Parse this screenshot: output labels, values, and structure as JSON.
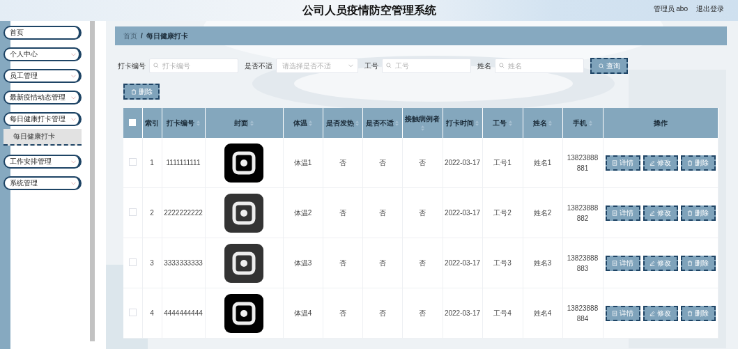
{
  "header": {
    "title": "公司人员疫情防空管理系统",
    "user": "管理员 abo",
    "logout": "退出登录"
  },
  "sidebar": {
    "items": [
      {
        "kind": "link",
        "label": "首页"
      },
      {
        "kind": "menu",
        "label": "个人中心"
      },
      {
        "kind": "menu",
        "label": "员工管理"
      },
      {
        "kind": "menu",
        "label": "最新疫情动态管理"
      },
      {
        "kind": "menu",
        "label": "每日健康打卡管理",
        "children": [
          {
            "label": "每日健康打卡",
            "selected": true
          }
        ]
      },
      {
        "kind": "menu",
        "label": "工作安排管理"
      },
      {
        "kind": "menu",
        "label": "系统管理"
      }
    ]
  },
  "breadcrumb": {
    "items": [
      "首页",
      "每日健康打卡"
    ],
    "separator": "/"
  },
  "filters": [
    {
      "kind": "input",
      "label": "打卡编号",
      "placeholder": "打卡编号"
    },
    {
      "kind": "select",
      "label": "是否不适",
      "placeholder": "请选择是否不适"
    },
    {
      "kind": "input",
      "label": "工号",
      "placeholder": "工号"
    },
    {
      "kind": "input",
      "label": "姓名",
      "placeholder": "姓名"
    }
  ],
  "search_button": "查询",
  "delete_button": "删除",
  "table": {
    "select_all": {
      "checked": false
    },
    "columns": [
      {
        "label": "索引",
        "sortable": false
      },
      {
        "label": "打卡编号",
        "sortable": true
      },
      {
        "label": "封面",
        "sortable": true
      },
      {
        "label": "体温",
        "sortable": true
      },
      {
        "label": "是否发热",
        "sortable": true
      },
      {
        "label": "是否不适",
        "sortable": true
      },
      {
        "label": "接触病例者",
        "sortable": true
      },
      {
        "label": "打卡时间",
        "sortable": true
      },
      {
        "label": "工号",
        "sortable": true
      },
      {
        "label": "姓名",
        "sortable": true
      },
      {
        "label": "手机",
        "sortable": true
      },
      {
        "label": "操作",
        "sortable": false
      }
    ],
    "rows": [
      {
        "checked": false,
        "index": "1",
        "id": "1111111111",
        "cover": {
          "kind": "picture",
          "color": "#000000"
        },
        "temperature": "体温1",
        "fever": "否",
        "discomfort": "否",
        "contact": "否",
        "time": "2022-03-17",
        "emp_no": "工号1",
        "name": "姓名1",
        "phone": "13823888881",
        "actions": [
          {
            "kind": "detail",
            "label": "详情"
          },
          {
            "kind": "edit",
            "label": "修改"
          },
          {
            "kind": "delete",
            "label": "删除"
          }
        ]
      },
      {
        "checked": false,
        "index": "2",
        "id": "2222222222",
        "cover": {
          "kind": "picture",
          "color": "#333333"
        },
        "temperature": "体温2",
        "fever": "否",
        "discomfort": "否",
        "contact": "否",
        "time": "2022-03-17",
        "emp_no": "工号2",
        "name": "姓名2",
        "phone": "13823888882",
        "actions": [
          {
            "kind": "detail",
            "label": "详情"
          },
          {
            "kind": "edit",
            "label": "修改"
          },
          {
            "kind": "delete",
            "label": "删除"
          }
        ]
      },
      {
        "checked": false,
        "index": "3",
        "id": "3333333333",
        "cover": {
          "kind": "picture",
          "color": "#333333"
        },
        "temperature": "体温3",
        "fever": "否",
        "discomfort": "否",
        "contact": "否",
        "time": "2022-03-17",
        "emp_no": "工号3",
        "name": "姓名3",
        "phone": "13823888883",
        "actions": [
          {
            "kind": "detail",
            "label": "详情"
          },
          {
            "kind": "edit",
            "label": "修改"
          },
          {
            "kind": "delete",
            "label": "删除"
          }
        ]
      },
      {
        "checked": false,
        "index": "4",
        "id": "4444444444",
        "cover": {
          "kind": "picture",
          "color": "#000000"
        },
        "temperature": "体温4",
        "fever": "否",
        "discomfort": "否",
        "contact": "否",
        "time": "2022-03-17",
        "emp_no": "工号4",
        "name": "姓名4",
        "phone": "13823888884",
        "actions": [
          {
            "kind": "detail",
            "label": "详情"
          },
          {
            "kind": "edit",
            "label": "修改"
          },
          {
            "kind": "delete",
            "label": "删除"
          }
        ]
      }
    ]
  }
}
